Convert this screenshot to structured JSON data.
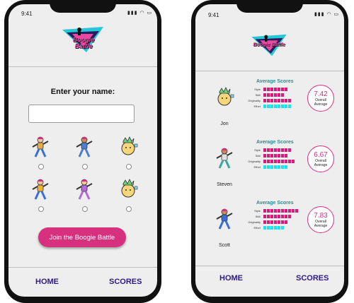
{
  "status": {
    "time": "9:41"
  },
  "app": {
    "logo_line1": "Boogie",
    "logo_line2": "Battle"
  },
  "join_screen": {
    "prompt": "Enter your name:",
    "name_value": "",
    "join_label": "Join the Boogie Battle"
  },
  "scores_screen": {
    "averages_title": "Average Scores",
    "overall_label_1": "Overall",
    "overall_label_2": "Average",
    "rating_labels": [
      "Style",
      "Skill",
      "Originality",
      "Effort"
    ],
    "players": [
      {
        "name": "Jon",
        "overall": "7.42",
        "ratings": [
          7,
          6,
          8,
          8
        ]
      },
      {
        "name": "Steven",
        "overall": "6.67",
        "ratings": [
          8,
          7,
          9,
          7
        ]
      },
      {
        "name": "Scott",
        "overall": "7.83",
        "ratings": [
          10,
          8,
          7,
          6
        ]
      }
    ]
  },
  "nav": {
    "home": "HOME",
    "scores": "SCORES"
  },
  "colors": {
    "accent": "#d7307f",
    "bar_magenta": "#d81b7b",
    "bar_cyan": "#19e3f0",
    "nav_text": "#2f1a86",
    "avg_title": "#2b8c93"
  },
  "icons": [
    "dancer-icon",
    "wifi-icon",
    "battery-icon",
    "signal-icon"
  ]
}
